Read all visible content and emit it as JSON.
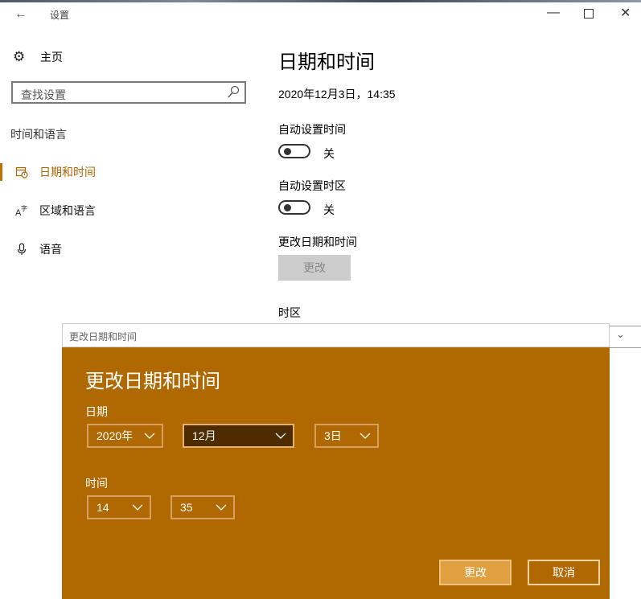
{
  "window": {
    "title": "设置"
  },
  "sidebar": {
    "home_label": "主页",
    "search_placeholder": "查找设置",
    "section_title": "时间和语言",
    "items": [
      {
        "label": "日期和时间",
        "icon": "calendar-clock-icon",
        "active": true
      },
      {
        "label": "区域和语言",
        "icon": "language-icon",
        "active": false
      },
      {
        "label": "语音",
        "icon": "microphone-icon",
        "active": false
      }
    ]
  },
  "main": {
    "title": "日期和时间",
    "current_datetime": "2020年12月3日，14:35",
    "auto_time_label": "自动设置时间",
    "auto_time_state": "关",
    "auto_timezone_label": "自动设置时区",
    "auto_timezone_state": "关",
    "change_datetime_label": "更改日期和时间",
    "change_button": "更改",
    "timezone_label": "时区"
  },
  "dialog": {
    "window_title": "更改日期和时间",
    "heading": "更改日期和时间",
    "date_label": "日期",
    "year": "2020年",
    "month": "12月",
    "day": "3日",
    "time_label": "时间",
    "hour": "14",
    "minute": "35",
    "ok_button": "更改",
    "cancel_button": "取消"
  },
  "colors": {
    "accent": "#b06800",
    "dialog_background": "#b06800",
    "active_dropdown": "#4e2c00",
    "ok_button": "#e0a040"
  }
}
